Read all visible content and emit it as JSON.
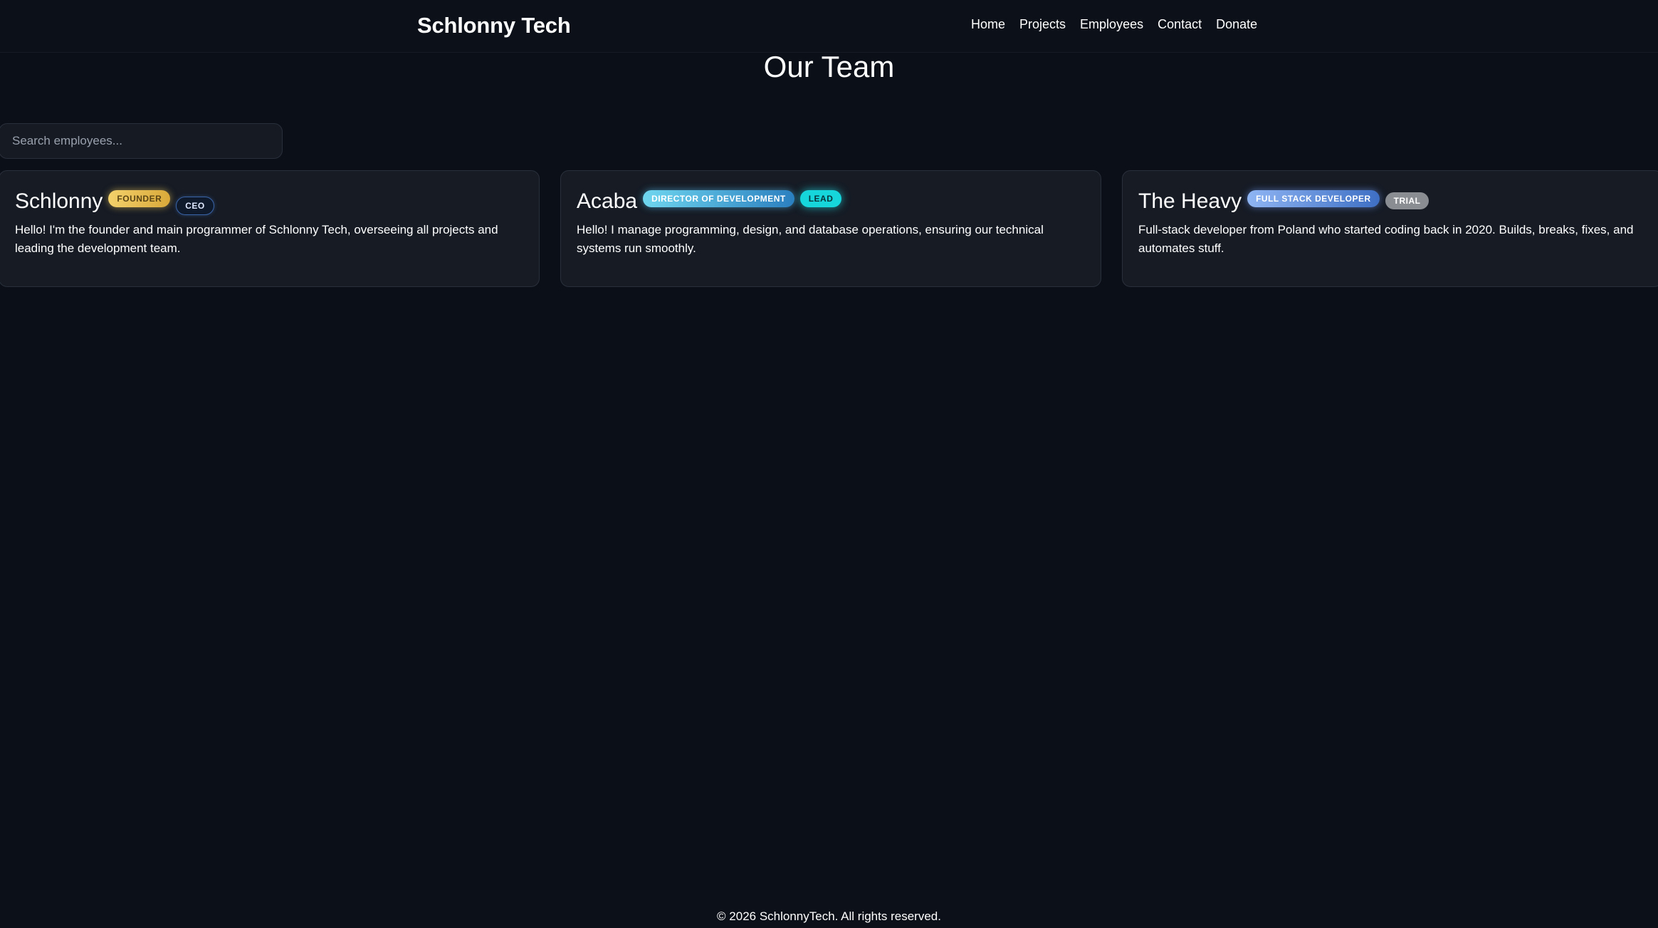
{
  "header": {
    "brand": "Schlonny Tech",
    "nav": [
      "Home",
      "Projects",
      "Employees",
      "Contact",
      "Donate"
    ]
  },
  "main": {
    "title": "Our Team",
    "search": {
      "placeholder": "Search employees...",
      "value": ""
    },
    "employees": [
      {
        "name": "Schlonny",
        "badges": [
          "FOUNDER",
          "CEO"
        ],
        "description": "Hello! I'm the founder and main programmer of Schlonny Tech, overseeing all projects and leading the development team."
      },
      {
        "name": "Acaba",
        "badges": [
          "DIRECTOR OF DEVELOPMENT",
          "LEAD"
        ],
        "description": "Hello! I manage programming, design, and database operations, ensuring our technical systems run smoothly."
      },
      {
        "name": "The Heavy",
        "badges": [
          "FULL STACK DEVELOPER",
          "TRIAL"
        ],
        "description": "Full-stack developer from Poland who started coding back in 2020. Builds, breaks, fixes, and automates stuff."
      }
    ]
  },
  "footer": {
    "text": "© 2026 SchlonnyTech. All rights reserved."
  },
  "colors": {
    "background": "#0b0f17",
    "card": "#161b24",
    "founder_badge": "#f3d16b",
    "lead_badge": "#16d6dc",
    "trial_badge": "#8a8d92"
  }
}
